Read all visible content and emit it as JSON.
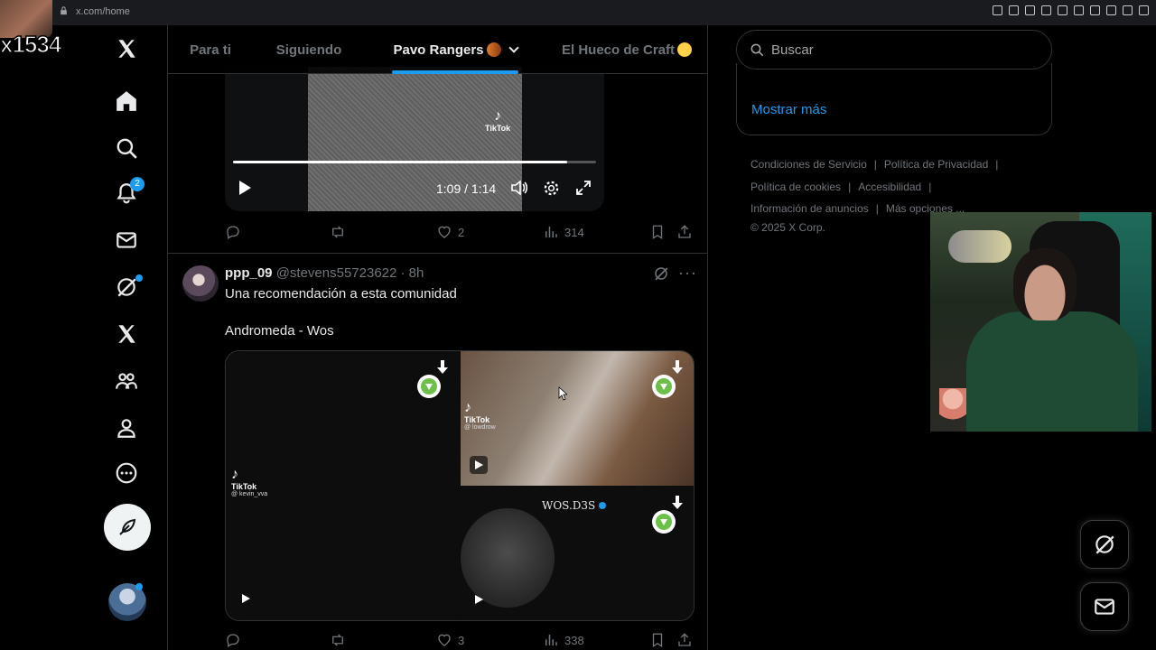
{
  "browser": {
    "url": "x.com/home"
  },
  "overlay": {
    "streamer_tag": "x1534"
  },
  "nav": {
    "notifications_badge": "2"
  },
  "tabs": [
    {
      "label": "Para ti",
      "active": false
    },
    {
      "label": "Siguiendo",
      "active": false
    },
    {
      "label": "Pavo Rangers",
      "active": true
    },
    {
      "label": "El Hueco de Craft",
      "active": false
    }
  ],
  "tweet1": {
    "video": {
      "time": "1:09 / 1:14",
      "progress": 0.92,
      "tiktok_label": "TikTok"
    },
    "actions": {
      "likes": "2",
      "views": "314"
    }
  },
  "tweet2": {
    "name": "ppp_09",
    "meta": "@stevens55723622 · 8h",
    "text1": "Una recomendación a esta comunidad",
    "text2": "Andromeda - Wos",
    "media": {
      "left_tiktok": "TikTok",
      "left_handle": "@ kevin_vva",
      "tr_tiktok": "TikTok",
      "tr_handle": "@ lowdrow",
      "br_caption": "WOS.D3S"
    },
    "actions": {
      "likes": "3",
      "views": "338"
    }
  },
  "sidebar": {
    "search_placeholder": "Buscar",
    "show_more": "Mostrar más",
    "footer": {
      "terms": "Condiciones de Servicio",
      "privacy": "Política de Privacidad",
      "cookies": "Política de cookies",
      "accessibility": "Accesibilidad",
      "ads": "Información de anuncios",
      "more": "Más opciones ...",
      "copyright": "© 2025 X Corp."
    }
  },
  "colors": {
    "accent": "#1d9bf0",
    "background": "#000000",
    "border": "#2f3336",
    "muted": "#71767b"
  },
  "icons": [
    "x-logo-icon",
    "home-icon",
    "search-icon",
    "bell-icon",
    "mail-icon",
    "grok-icon",
    "x-premium-icon",
    "communities-icon",
    "profile-icon",
    "more-icon",
    "post-feather-icon",
    "reply-icon",
    "retweet-icon",
    "like-icon",
    "views-icon",
    "bookmark-icon",
    "share-icon",
    "download-icon"
  ]
}
